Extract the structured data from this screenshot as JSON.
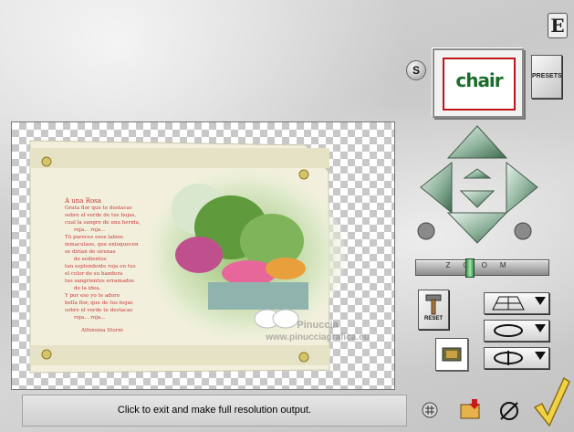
{
  "toolbar": {
    "s_label": "S",
    "presets_label": "PRESETS",
    "reset_label": "RESET",
    "zoom_label": "ZOOM"
  },
  "preset_thumbnail": {
    "text": "chair"
  },
  "preview": {
    "poem_title": "A una Rosa",
    "poem_lines": [
      "Grata flor que te destacas",
      "sobre el verde de tus hojas,",
      "cual la sangre de una herida,",
      "roja... roja...",
      "Tú pareces esos labios",
      "inmaculaos, que enloquecen",
      "se dirían de sirenas",
      "de sedientos",
      "tan esplendente roja en tus",
      "el color de su bandera",
      "tus sangrientos erramados",
      "de la idea.",
      "Y por eso yo te adoro",
      "bella flor, que de tus hojas",
      "sobre el verde te destacas",
      "roja... roja..."
    ],
    "poem_author": "Alfonsina Storni"
  },
  "watermark": {
    "name": "Pinuccia",
    "url": "www.pinucciagrafica.eu"
  },
  "status_bar": {
    "text": "Click to exit and make full resolution output."
  },
  "icons": {
    "logo": "E",
    "ok": "checkmark-icon",
    "grid": "grid-icon",
    "open": "folder-open-icon",
    "clear": "clear-icon"
  }
}
